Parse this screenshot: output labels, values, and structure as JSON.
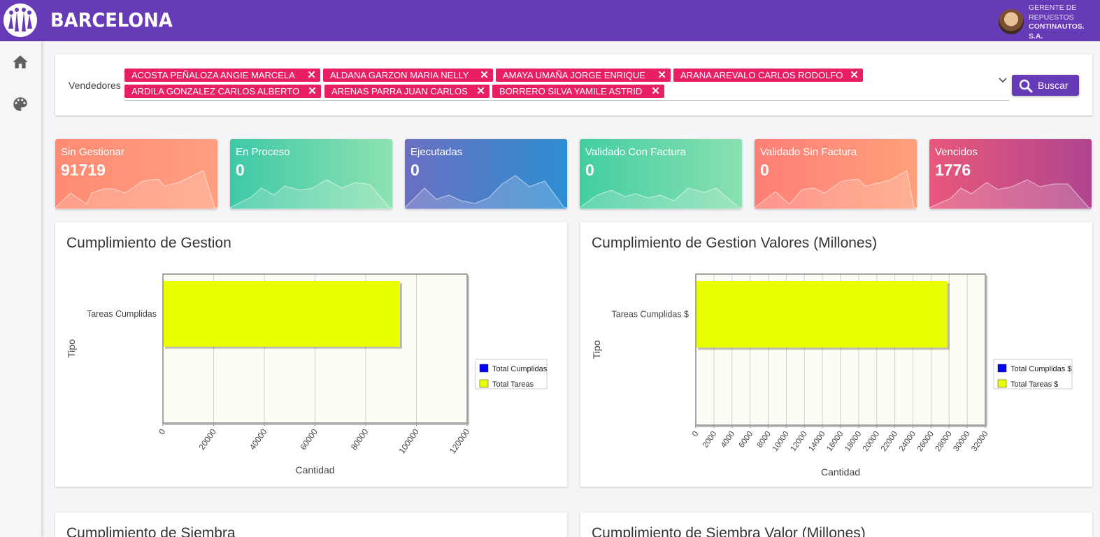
{
  "app": {
    "brand": "BARCELONA",
    "user": {
      "role": "GERENTE DE REPUESTOS",
      "company": "CONTINAUTOS. S.A."
    }
  },
  "sidebar": {
    "items": [
      {
        "icon": "home-icon"
      },
      {
        "icon": "palette-icon"
      }
    ]
  },
  "filter": {
    "label": "Vendedores",
    "chips": [
      "ACOSTA PEÑALOZA ANGIE MARCELA",
      "ALDANA GARZON MARIA NELLY",
      "AMAYA UMAÑA JORGE ENRIQUE",
      "ARANA AREVALO CARLOS RODOLFO",
      "ARDILA GONZALEZ CARLOS ALBERTO",
      "ARENAS PARRA JUAN CARLOS",
      "BORRERO SILVA YAMILE ASTRID"
    ],
    "search_label": "Buscar"
  },
  "stats": [
    {
      "label": "Sin Gestionar",
      "value": "91719",
      "gradient": [
        "#ff8a72",
        "#ff9f80"
      ]
    },
    {
      "label": "En Proceso",
      "value": "0",
      "gradient": [
        "#3ec9a7",
        "#8de2b0"
      ]
    },
    {
      "label": "Ejecutadas",
      "value": "0",
      "gradient": [
        "#6a6fc2",
        "#2d8ed1"
      ]
    },
    {
      "label": "Validado Con Factura",
      "value": "0",
      "gradient": [
        "#43cea2",
        "#89e0b0"
      ]
    },
    {
      "label": "Validado Sin Factura",
      "value": "0",
      "gradient": [
        "#fe7e76",
        "#ffa07a"
      ]
    },
    {
      "label": "Vencidos",
      "value": "1776",
      "gradient": [
        "#e8587a",
        "#b0458f"
      ]
    }
  ],
  "chart_data": [
    {
      "type": "bar",
      "title": "Cumplimiento de Gestion",
      "orientation": "horizontal",
      "categories": [
        "Tareas Cumplidas"
      ],
      "series": [
        {
          "name": "Total Cumplidas",
          "values": [
            0
          ],
          "color": "#0000ff"
        },
        {
          "name": "Total Tareas",
          "values": [
            93500
          ],
          "color": "#eaff00"
        }
      ],
      "xlabel": "Cantidad",
      "ylabel": "Tipo",
      "xlim": [
        0,
        120000
      ],
      "ticks": [
        "0",
        "20000",
        "40000",
        "60000",
        "80000",
        "100000",
        "120000"
      ],
      "grid": true,
      "legend": "right"
    },
    {
      "type": "bar",
      "title": "Cumplimiento de Gestion Valores (Millones)",
      "orientation": "horizontal",
      "categories": [
        "Tareas Cumplidas $"
      ],
      "series": [
        {
          "name": "Total Cumplidas $",
          "values": [
            0
          ],
          "color": "#0000ff"
        },
        {
          "name": "Total Tareas $",
          "values": [
            27800
          ],
          "color": "#eaff00"
        }
      ],
      "xlabel": "Cantidad",
      "ylabel": "Tipo",
      "xlim": [
        0,
        32000
      ],
      "ticks": [
        "0",
        "2000",
        "4000",
        "6000",
        "8000",
        "10000",
        "12000",
        "14000",
        "16000",
        "18000",
        "20000",
        "22000",
        "24000",
        "26000",
        "28000",
        "30000",
        "32000"
      ],
      "grid": true,
      "legend": "right"
    }
  ],
  "lower_titles": [
    "Cumplimiento de Siembra",
    "Cumplimiento de Siembra Valor (Millones)"
  ]
}
